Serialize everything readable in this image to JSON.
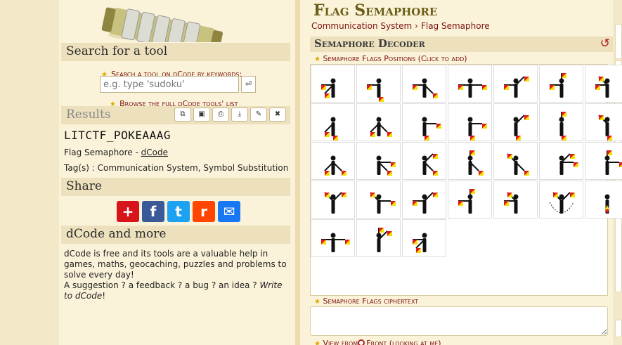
{
  "left": {
    "search_title": "Search for a tool",
    "search_hint": "Search a tool on dCode by keywords:",
    "search_placeholder": "e.g. type 'sudoku'",
    "go_icon": "enter-icon",
    "browse_prefix": "Browse the ",
    "browse_link": "full dCode tools' list",
    "results_title": "Results",
    "result_tools": [
      "copy-icon",
      "save-icon",
      "print-icon",
      "download-icon",
      "pin-icon",
      "close-icon"
    ],
    "result_value": "LITCTF_POKEAAAG",
    "tool_name_prefix": "Flag Semaphore - ",
    "tool_name_link": "dCode",
    "tags": "Tag(s) : Communication System, Symbol Substitution",
    "share_title": "Share",
    "share_buttons": [
      {
        "icon": "add-icon",
        "color": "#d7141a",
        "glyph": "+"
      },
      {
        "icon": "facebook-icon",
        "color": "#3b5998",
        "glyph": "f"
      },
      {
        "icon": "twitter-icon",
        "color": "#1da1f2",
        "glyph": "t"
      },
      {
        "icon": "reddit-icon",
        "color": "#ff4500",
        "glyph": "r"
      },
      {
        "icon": "mail-icon",
        "color": "#1877f2",
        "glyph": "✉"
      }
    ],
    "more_title": "dCode and more",
    "about_text": "dCode is free and its tools are a valuable help in games, maths, geocaching, puzzles and problems to solve every day!",
    "suggestion_text": "A suggestion ? a feedback ? a bug ? an idea ? ",
    "write_link": "Write to dCode",
    "write_end": "!"
  },
  "main": {
    "title": "Flag Semaphore",
    "breadcrumbs": [
      "Communication System",
      "Flag Semaphore"
    ],
    "decoder_title": "Semaphore Decoder",
    "reset_icon": "reset-icon",
    "positions_label": "Semaphore Flags Positions (Click to add)",
    "ciphertext_label": "Semaphore Flags ciphertext",
    "view_label": "View from",
    "view_option": "Front (looking at me)"
  },
  "colors": {
    "flag_red": "#e01a1a",
    "flag_yellow": "#f2e000",
    "title": "#6b5d17",
    "link": "#7a1010"
  }
}
